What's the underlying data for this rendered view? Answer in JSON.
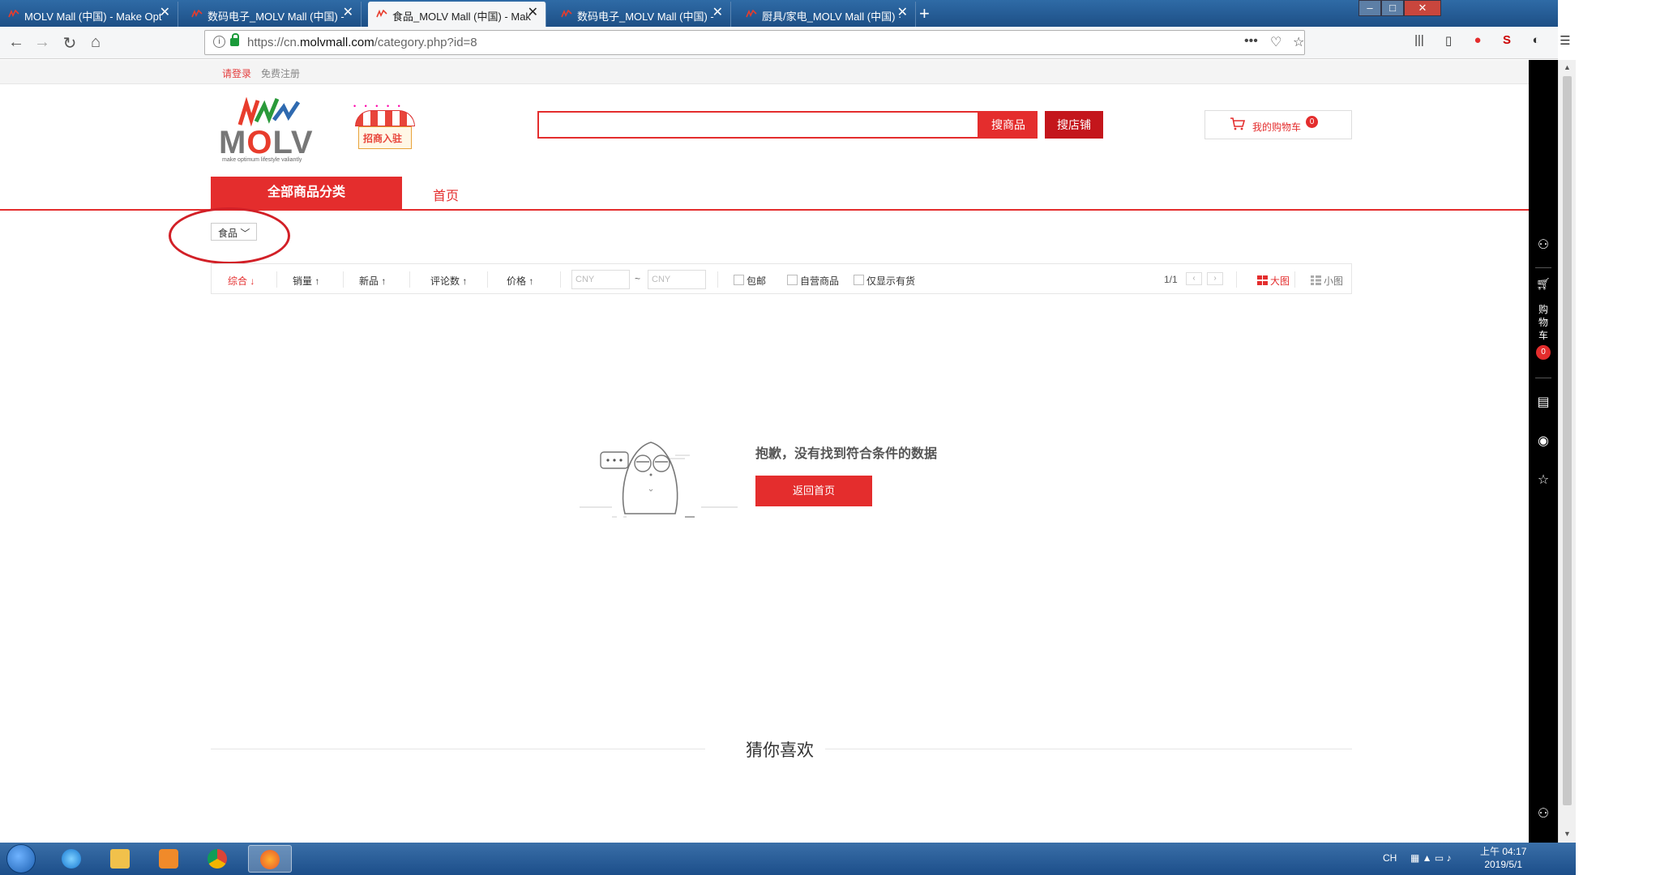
{
  "browser": {
    "tabs": [
      {
        "label": "MOLV Mall (中国) - Make Opt",
        "active": false
      },
      {
        "label": "数码电子_MOLV Mall (中国) -",
        "active": false
      },
      {
        "label": "食品_MOLV Mall (中国) - Mak",
        "active": true
      },
      {
        "label": "数码电子_MOLV Mall (中国) -",
        "active": false
      },
      {
        "label": "厨具/家电_MOLV Mall (中国) ·",
        "active": false
      }
    ],
    "url_prefix": "https://cn.",
    "url_domain": "molvmall.com",
    "url_path": "/category.php?id=8"
  },
  "header": {
    "login": "请登录",
    "register": "免费注册",
    "logo_text_left": "M",
    "logo_text_o": "O",
    "logo_text_right": "LV",
    "logo_tagline": "make optimum lifestyle valiantly",
    "merchant_label": "招商入驻",
    "search_value": "",
    "search_goods_btn": "搜商品",
    "search_shop_btn": "搜店铺",
    "cart_label": "我的购物车",
    "cart_count": "0"
  },
  "nav": {
    "all_categories": "全部商品分类",
    "home": "首页"
  },
  "breadcrumb": {
    "label": "食品"
  },
  "filters": {
    "sorts": [
      {
        "label": "综合",
        "arrow": "↓",
        "active": true
      },
      {
        "label": "销量",
        "arrow": "↑",
        "active": false
      },
      {
        "label": "新品",
        "arrow": "↑",
        "active": false
      },
      {
        "label": "评论数",
        "arrow": "↑",
        "active": false
      },
      {
        "label": "价格",
        "arrow": "↑",
        "active": false
      }
    ],
    "price_min_placeholder": "CNY",
    "price_max_placeholder": "CNY",
    "price_sep": "~",
    "checkboxes": [
      {
        "label": "包邮",
        "checked": false
      },
      {
        "label": "自营商品",
        "checked": false
      },
      {
        "label": "仅显示有货",
        "checked": false
      }
    ],
    "page_indicator": "1/1",
    "view_big": "大图",
    "view_small": "小图"
  },
  "empty": {
    "message": "抱歉，没有找到符合条件的数据",
    "button": "返回首页"
  },
  "recommend": {
    "title": "猜你喜欢"
  },
  "sidebar": {
    "cart_label": "购物车",
    "cart_count": "0"
  },
  "taskbar": {
    "ime": "CH",
    "time": "上午 04:17",
    "date": "2019/5/1"
  },
  "colors": {
    "accent": "#e42d2d",
    "accent_dark": "#c4161c",
    "annotation": "#d22027"
  }
}
